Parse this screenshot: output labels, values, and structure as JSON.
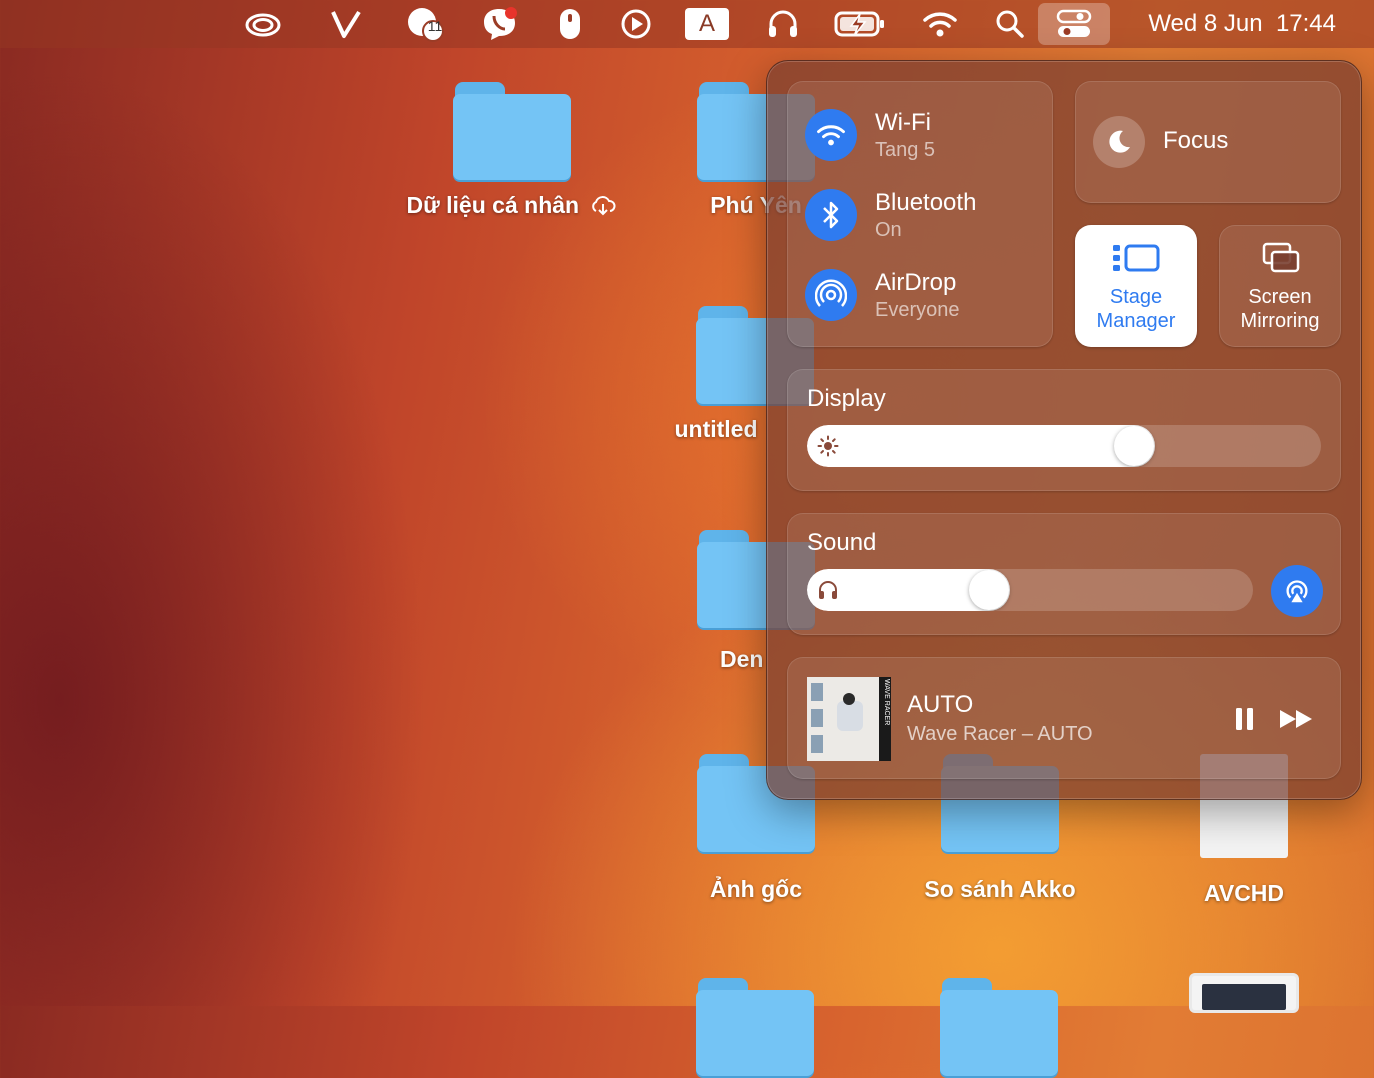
{
  "menubar": {
    "clock": "Wed 8 Jun  17:44",
    "notification_badge": "11",
    "input_source": "A",
    "icons": [
      "creative-cloud-icon",
      "v-app-icon",
      "messenger-badge-icon",
      "viber-icon",
      "mouse-icon",
      "play-icon",
      "input-source-icon",
      "headphones-icon",
      "battery-charging-icon",
      "wifi-icon",
      "search-icon",
      "control-center-icon"
    ]
  },
  "desktop": {
    "items": [
      {
        "label": "Dữ liệu cá nhân"
      },
      {
        "label": "Phú Yên"
      },
      {
        "label": "untitled"
      },
      {
        "label": "Den"
      },
      {
        "label": "Ảnh gốc"
      },
      {
        "label": "So sánh Akko"
      },
      {
        "label": "AVCHD"
      }
    ]
  },
  "control_center": {
    "wifi": {
      "title": "Wi-Fi",
      "subtitle": "Tang 5"
    },
    "bluetooth": {
      "title": "Bluetooth",
      "subtitle": "On"
    },
    "airdrop": {
      "title": "AirDrop",
      "subtitle": "Everyone"
    },
    "focus": {
      "title": "Focus"
    },
    "stage_manager": {
      "line1": "Stage",
      "line2": "Manager",
      "active": true
    },
    "screen_mirroring": {
      "line1": "Screen",
      "line2": "Mirroring"
    },
    "display": {
      "title": "Display",
      "brightness": 0.65
    },
    "sound": {
      "title": "Sound",
      "volume": 0.4
    },
    "now_playing": {
      "title": "AUTO",
      "subtitle": "Wave Racer – AUTO",
      "album_art_text": "WAVE RACER"
    },
    "accent_color": "#2f7bf0"
  }
}
